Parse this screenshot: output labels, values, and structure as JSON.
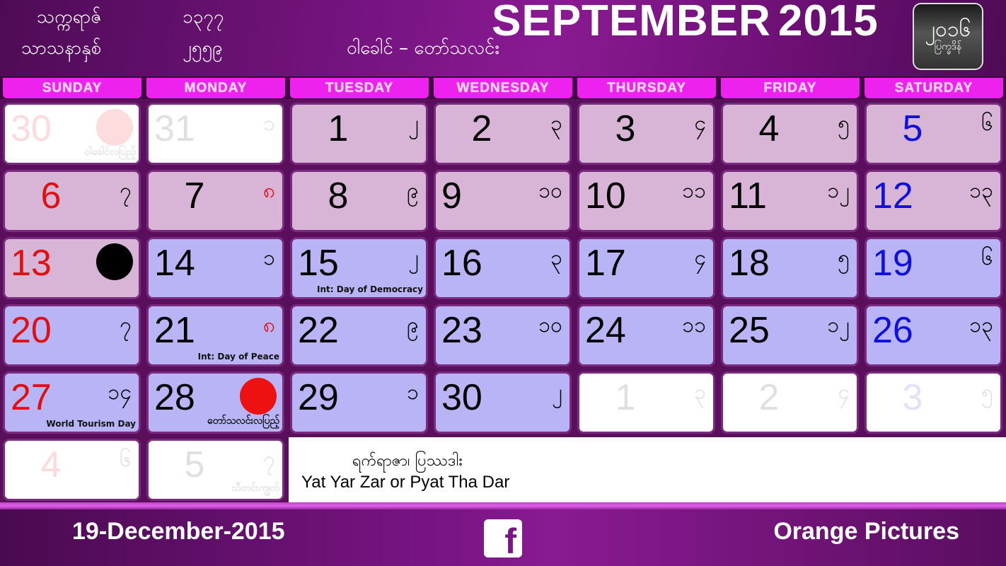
{
  "header": {
    "era_label_1": "သက္ကရာဇ်",
    "era_value_1": "၁၃၇၇",
    "era_label_2": "သာသနာနှစ်",
    "era_value_2": "၂၅၅၉",
    "myanmar_months": "ဝါခေါင် – တော်သလင်း",
    "month": "SEPTEMBER",
    "year": "2015",
    "logo_line1": "၂၀၁၆",
    "logo_line2": "ပြက္ခဒိန်"
  },
  "weekdays": [
    "SUNDAY",
    "MONDAY",
    "TUESDAY",
    "WEDNESDAY",
    "THURSDAY",
    "FRIDAY",
    "SATURDAY"
  ],
  "weeks": [
    [
      {
        "day": "30",
        "myanmar": "",
        "style": "out",
        "color": "red",
        "moon": "full",
        "note": "ဝါခေါင်လပြည့်"
      },
      {
        "day": "31",
        "myanmar": "၁",
        "style": "out"
      },
      {
        "day": "1",
        "myanmar": "၂",
        "style": "pink"
      },
      {
        "day": "2",
        "myanmar": "၃",
        "style": "pink"
      },
      {
        "day": "3",
        "myanmar": "၄",
        "style": "pink"
      },
      {
        "day": "4",
        "myanmar": "၅",
        "style": "pink"
      },
      {
        "day": "5",
        "myanmar": "၆",
        "style": "pink",
        "color": "blue"
      }
    ],
    [
      {
        "day": "6",
        "myanmar": "၇",
        "style": "pink",
        "color": "red"
      },
      {
        "day": "7",
        "myanmar": "၈",
        "style": "pink",
        "myanmar_color": "red"
      },
      {
        "day": "8",
        "myanmar": "၉",
        "style": "pink"
      },
      {
        "day": "9",
        "myanmar": "၁၀",
        "style": "pink"
      },
      {
        "day": "10",
        "myanmar": "၁၁",
        "style": "pink"
      },
      {
        "day": "11",
        "myanmar": "၁၂",
        "style": "pink"
      },
      {
        "day": "12",
        "myanmar": "၁၃",
        "style": "pink",
        "color": "blue"
      }
    ],
    [
      {
        "day": "13",
        "myanmar": "",
        "style": "pink",
        "color": "red",
        "moon": "new"
      },
      {
        "day": "14",
        "myanmar": "၁",
        "style": "blue"
      },
      {
        "day": "15",
        "myanmar": "၂",
        "style": "blue",
        "note": "Int: Day of Democracy"
      },
      {
        "day": "16",
        "myanmar": "၃",
        "style": "blue"
      },
      {
        "day": "17",
        "myanmar": "၄",
        "style": "blue"
      },
      {
        "day": "18",
        "myanmar": "၅",
        "style": "blue"
      },
      {
        "day": "19",
        "myanmar": "၆",
        "style": "blue",
        "color": "blue"
      }
    ],
    [
      {
        "day": "20",
        "myanmar": "၇",
        "style": "blue",
        "color": "red"
      },
      {
        "day": "21",
        "myanmar": "၈",
        "style": "blue",
        "myanmar_color": "red",
        "note": "Int: Day of Peace"
      },
      {
        "day": "22",
        "myanmar": "၉",
        "style": "blue"
      },
      {
        "day": "23",
        "myanmar": "၁၀",
        "style": "blue"
      },
      {
        "day": "24",
        "myanmar": "၁၁",
        "style": "blue"
      },
      {
        "day": "25",
        "myanmar": "၁၂",
        "style": "blue"
      },
      {
        "day": "26",
        "myanmar": "၁၃",
        "style": "blue",
        "color": "blue"
      }
    ],
    [
      {
        "day": "27",
        "myanmar": "၁၄",
        "style": "blue",
        "color": "red",
        "note": "World Tourism Day"
      },
      {
        "day": "28",
        "myanmar": "",
        "style": "blue",
        "moon": "full",
        "note": "တော်သလင်းလပြည့်"
      },
      {
        "day": "29",
        "myanmar": "၁",
        "style": "blue"
      },
      {
        "day": "30",
        "myanmar": "၂",
        "style": "blue"
      },
      {
        "day": "1",
        "myanmar": "၃",
        "style": "out"
      },
      {
        "day": "2",
        "myanmar": "၄",
        "style": "out"
      },
      {
        "day": "3",
        "myanmar": "၅",
        "style": "out",
        "color": "blue"
      }
    ],
    [
      {
        "day": "4",
        "myanmar": "၆",
        "style": "out",
        "color": "red"
      },
      {
        "day": "5",
        "myanmar": "၇",
        "style": "out",
        "note": "သီတင်းကျွတ်"
      }
    ]
  ],
  "info": {
    "myanmar_text": "ရက်ရာဇာ၊ ပြဿဒါး",
    "english_text": "Yat Yar Zar or Pyat Tha Dar"
  },
  "footer": {
    "date": "19-December-2015",
    "facebook_icon": "f",
    "brand": "Orange Pictures"
  }
}
